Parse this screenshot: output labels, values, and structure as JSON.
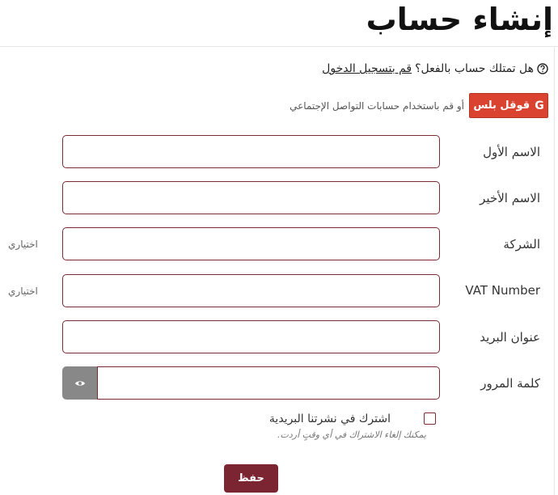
{
  "page": {
    "title": "إنشاء حساب"
  },
  "login_prompt": {
    "question": "هل تمتلك حساب بالفعل؟",
    "link": "قم بتسجيل الدخول"
  },
  "social": {
    "text": "أو قم باستخدام حسابات التواصل الإجتماعي",
    "google_label": "قوقل بلس",
    "google_icon": "google-g-icon",
    "google_color": "#d9432f"
  },
  "form": {
    "first_name": {
      "label": "الاسم الأول",
      "value": ""
    },
    "last_name": {
      "label": "الاسم الأخير",
      "value": ""
    },
    "company": {
      "label": "الشركة",
      "optional": "اختياري",
      "value": ""
    },
    "vat": {
      "label": "VAT Number",
      "optional": "اختياري",
      "value": ""
    },
    "email": {
      "label": "عنوان البريد",
      "value": ""
    },
    "password": {
      "label": "كلمة المرور",
      "value": "",
      "toggle_icon": "eye-icon"
    },
    "newsletter": {
      "label": "اشترك في نشرتنا البريدية",
      "hint": "يمكنك إلغاء الاشتراك في أي وقتٍ أردت.",
      "checked": false
    },
    "save_label": "حفظ"
  },
  "colors": {
    "accent": "#7b2533",
    "input_border": "#7a2a35",
    "eye_button": "#888888"
  }
}
